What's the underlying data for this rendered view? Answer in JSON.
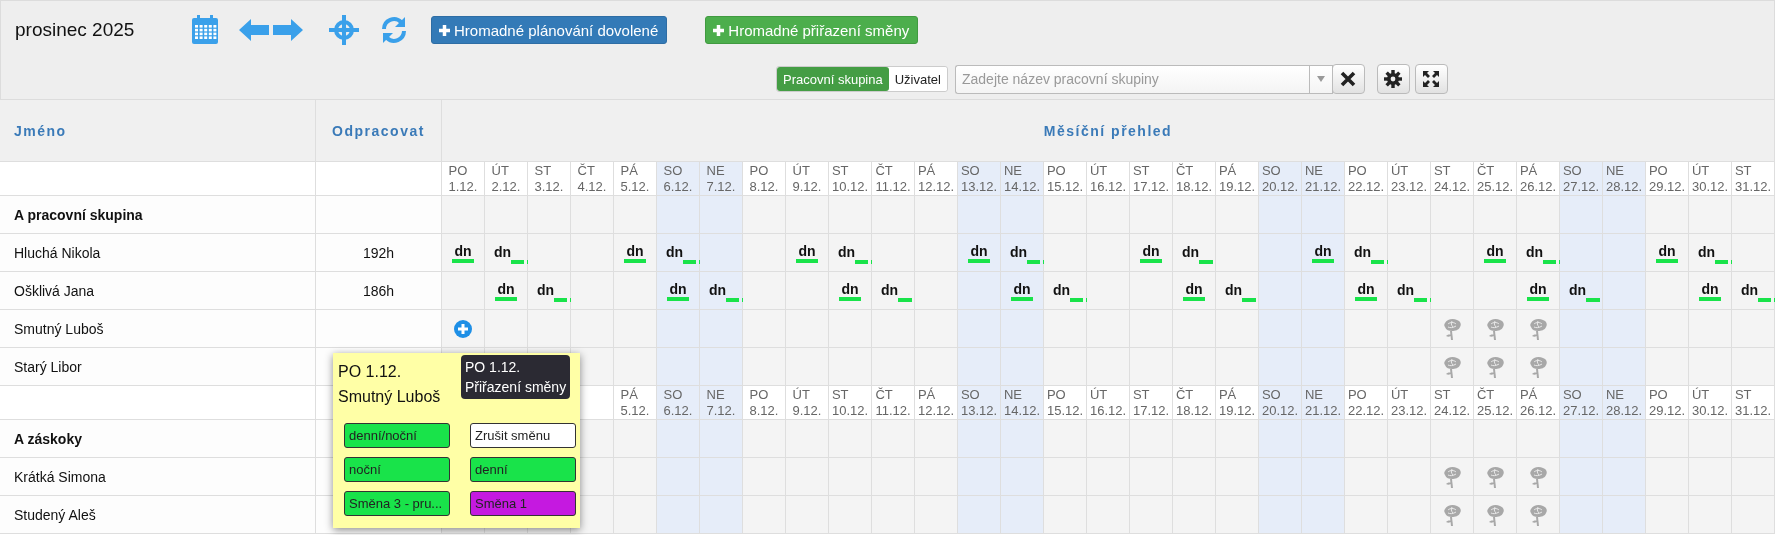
{
  "toolbar": {
    "title": "prosinec 2025",
    "buttons": [
      {
        "label": "Hromadné plánování dovolené",
        "kind": "primary"
      },
      {
        "label": "Hromadné přiřazení směny",
        "kind": "success"
      }
    ],
    "filter_toggle": [
      {
        "label": "Pracovní skupina",
        "selected": true
      },
      {
        "label": "Uživatel",
        "selected": false
      }
    ],
    "search": {
      "placeholder": "Zadejte název pracovní skupiny"
    }
  },
  "table": {
    "columns": [
      "Jméno",
      "Odpracovat",
      "Měsíční přehled"
    ],
    "days": [
      {
        "weekday": "PO",
        "date": "1.12.",
        "weekend": false
      },
      {
        "weekday": "ÚT",
        "date": "2.12.",
        "weekend": false
      },
      {
        "weekday": "ST",
        "date": "3.12.",
        "weekend": false
      },
      {
        "weekday": "ČT",
        "date": "4.12.",
        "weekend": false
      },
      {
        "weekday": "PÁ",
        "date": "5.12.",
        "weekend": false
      },
      {
        "weekday": "SO",
        "date": "6.12.",
        "weekend": true
      },
      {
        "weekday": "NE",
        "date": "7.12.",
        "weekend": true
      },
      {
        "weekday": "PO",
        "date": "8.12.",
        "weekend": false
      },
      {
        "weekday": "ÚT",
        "date": "9.12.",
        "weekend": false
      },
      {
        "weekday": "ST",
        "date": "10.12.",
        "weekend": false
      },
      {
        "weekday": "ČT",
        "date": "11.12.",
        "weekend": false
      },
      {
        "weekday": "PÁ",
        "date": "12.12.",
        "weekend": false
      },
      {
        "weekday": "SO",
        "date": "13.12.",
        "weekend": true
      },
      {
        "weekday": "NE",
        "date": "14.12.",
        "weekend": true
      },
      {
        "weekday": "PO",
        "date": "15.12.",
        "weekend": false
      },
      {
        "weekday": "ÚT",
        "date": "16.12.",
        "weekend": false
      },
      {
        "weekday": "ST",
        "date": "17.12.",
        "weekend": false
      },
      {
        "weekday": "ČT",
        "date": "18.12.",
        "weekend": false
      },
      {
        "weekday": "PÁ",
        "date": "19.12.",
        "weekend": false
      },
      {
        "weekday": "SO",
        "date": "20.12.",
        "weekend": true
      },
      {
        "weekday": "NE",
        "date": "21.12.",
        "weekend": true
      },
      {
        "weekday": "PO",
        "date": "22.12.",
        "weekend": false
      },
      {
        "weekday": "ÚT",
        "date": "23.12.",
        "weekend": false
      },
      {
        "weekday": "ST",
        "date": "24.12.",
        "weekend": false
      },
      {
        "weekday": "ČT",
        "date": "25.12.",
        "weekend": false
      },
      {
        "weekday": "PÁ",
        "date": "26.12.",
        "weekend": false
      },
      {
        "weekday": "SO",
        "date": "27.12.",
        "weekend": true
      },
      {
        "weekday": "NE",
        "date": "28.12.",
        "weekend": true
      },
      {
        "weekday": "PO",
        "date": "29.12.",
        "weekend": false
      },
      {
        "weekday": "ÚT",
        "date": "30.12.",
        "weekend": false
      },
      {
        "weekday": "ST",
        "date": "31.12.",
        "weekend": false
      }
    ],
    "rows": [
      {
        "kind": "group",
        "name": "A pracovní skupina"
      },
      {
        "kind": "person",
        "name": "Hluchá Nikola",
        "hours": "192h",
        "cells": [
          {
            "kind": "shift",
            "label": "dn"
          },
          {
            "kind": "overnight",
            "label": "dn"
          },
          {
            "kind": "empty"
          },
          {
            "kind": "empty"
          },
          {
            "kind": "shift",
            "label": "dn"
          },
          {
            "kind": "overnight",
            "label": "dn"
          },
          {
            "kind": "empty"
          },
          {
            "kind": "empty"
          },
          {
            "kind": "shift",
            "label": "dn"
          },
          {
            "kind": "overnight",
            "label": "dn"
          },
          {
            "kind": "empty"
          },
          {
            "kind": "empty"
          },
          {
            "kind": "shift",
            "label": "dn"
          },
          {
            "kind": "overnight",
            "label": "dn"
          },
          {
            "kind": "empty"
          },
          {
            "kind": "empty"
          },
          {
            "kind": "shift",
            "label": "dn"
          },
          {
            "kind": "overnight",
            "label": "dn"
          },
          {
            "kind": "empty"
          },
          {
            "kind": "empty"
          },
          {
            "kind": "shift",
            "label": "dn"
          },
          {
            "kind": "overnight",
            "label": "dn"
          },
          {
            "kind": "empty"
          },
          {
            "kind": "empty"
          },
          {
            "kind": "shift",
            "label": "dn"
          },
          {
            "kind": "overnight",
            "label": "dn"
          },
          {
            "kind": "empty"
          },
          {
            "kind": "empty"
          },
          {
            "kind": "shift",
            "label": "dn"
          },
          {
            "kind": "overnight",
            "label": "dn"
          },
          {
            "kind": "empty"
          }
        ]
      },
      {
        "kind": "person",
        "name": "Ošklivá Jana",
        "hours": "186h",
        "cells": [
          {
            "kind": "empty"
          },
          {
            "kind": "shift",
            "label": "dn"
          },
          {
            "kind": "overnight",
            "label": "dn"
          },
          {
            "kind": "empty"
          },
          {
            "kind": "empty"
          },
          {
            "kind": "shift",
            "label": "dn"
          },
          {
            "kind": "overnight",
            "label": "dn"
          },
          {
            "kind": "empty"
          },
          {
            "kind": "empty"
          },
          {
            "kind": "shift",
            "label": "dn"
          },
          {
            "kind": "overnight",
            "label": "dn"
          },
          {
            "kind": "empty"
          },
          {
            "kind": "empty"
          },
          {
            "kind": "shift",
            "label": "dn"
          },
          {
            "kind": "overnight",
            "label": "dn"
          },
          {
            "kind": "empty"
          },
          {
            "kind": "empty"
          },
          {
            "kind": "shift",
            "label": "dn"
          },
          {
            "kind": "overnight",
            "label": "dn"
          },
          {
            "kind": "empty"
          },
          {
            "kind": "empty"
          },
          {
            "kind": "shift",
            "label": "dn"
          },
          {
            "kind": "overnight",
            "label": "dn"
          },
          {
            "kind": "empty"
          },
          {
            "kind": "empty"
          },
          {
            "kind": "shift",
            "label": "dn"
          },
          {
            "kind": "overnight",
            "label": "dn"
          },
          {
            "kind": "empty"
          },
          {
            "kind": "empty"
          },
          {
            "kind": "shift",
            "label": "dn"
          },
          {
            "kind": "overnight",
            "label": "dn"
          }
        ]
      },
      {
        "kind": "person",
        "name": "Smutný Luboš",
        "cells": [
          {
            "kind": "add"
          },
          {
            "kind": "empty"
          },
          {
            "kind": "empty"
          },
          {
            "kind": "empty"
          },
          {
            "kind": "empty"
          },
          {
            "kind": "empty"
          },
          {
            "kind": "empty"
          },
          {
            "kind": "empty"
          },
          {
            "kind": "empty"
          },
          {
            "kind": "empty"
          },
          {
            "kind": "empty"
          },
          {
            "kind": "empty"
          },
          {
            "kind": "empty"
          },
          {
            "kind": "empty"
          },
          {
            "kind": "empty"
          },
          {
            "kind": "empty"
          },
          {
            "kind": "empty"
          },
          {
            "kind": "empty"
          },
          {
            "kind": "empty"
          },
          {
            "kind": "empty"
          },
          {
            "kind": "empty"
          },
          {
            "kind": "empty"
          },
          {
            "kind": "empty"
          },
          {
            "kind": "holiday"
          },
          {
            "kind": "holiday"
          },
          {
            "kind": "holiday"
          },
          {
            "kind": "empty"
          },
          {
            "kind": "empty"
          },
          {
            "kind": "empty"
          },
          {
            "kind": "empty"
          },
          {
            "kind": "empty"
          }
        ]
      },
      {
        "kind": "person",
        "name": "Starý Libor",
        "cells": [
          {
            "kind": "empty"
          },
          {
            "kind": "empty"
          },
          {
            "kind": "empty"
          },
          {
            "kind": "empty"
          },
          {
            "kind": "empty"
          },
          {
            "kind": "empty"
          },
          {
            "kind": "empty"
          },
          {
            "kind": "empty"
          },
          {
            "kind": "empty"
          },
          {
            "kind": "empty"
          },
          {
            "kind": "empty"
          },
          {
            "kind": "empty"
          },
          {
            "kind": "empty"
          },
          {
            "kind": "empty"
          },
          {
            "kind": "empty"
          },
          {
            "kind": "empty"
          },
          {
            "kind": "empty"
          },
          {
            "kind": "empty"
          },
          {
            "kind": "empty"
          },
          {
            "kind": "empty"
          },
          {
            "kind": "empty"
          },
          {
            "kind": "empty"
          },
          {
            "kind": "empty"
          },
          {
            "kind": "holiday"
          },
          {
            "kind": "holiday"
          },
          {
            "kind": "holiday"
          },
          {
            "kind": "empty"
          },
          {
            "kind": "empty"
          },
          {
            "kind": "empty"
          },
          {
            "kind": "empty"
          },
          {
            "kind": "empty"
          }
        ]
      },
      {
        "kind": "days",
        "days": [
          {
            "weekday": "PÁ",
            "date": "5.12.",
            "weekend": false
          },
          {
            "weekday": "SO",
            "date": "6.12.",
            "weekend": true
          },
          {
            "weekday": "NE",
            "date": "7.12.",
            "weekend": true
          },
          {
            "weekday": "PO",
            "date": "8.12.",
            "weekend": false
          },
          {
            "weekday": "ÚT",
            "date": "9.12.",
            "weekend": false
          },
          {
            "weekday": "ST",
            "date": "10.12.",
            "weekend": false
          },
          {
            "weekday": "ČT",
            "date": "11.12.",
            "weekend": false
          },
          {
            "weekday": "PÁ",
            "date": "12.12.",
            "weekend": false
          },
          {
            "weekday": "SO",
            "date": "13.12.",
            "weekend": true
          },
          {
            "weekday": "NE",
            "date": "14.12.",
            "weekend": true
          },
          {
            "weekday": "PO",
            "date": "15.12.",
            "weekend": false
          },
          {
            "weekday": "ÚT",
            "date": "16.12.",
            "weekend": false
          },
          {
            "weekday": "ST",
            "date": "17.12.",
            "weekend": false
          },
          {
            "weekday": "ČT",
            "date": "18.12.",
            "weekend": false
          },
          {
            "weekday": "PÁ",
            "date": "19.12.",
            "weekend": false
          },
          {
            "weekday": "SO",
            "date": "20.12.",
            "weekend": true
          },
          {
            "weekday": "NE",
            "date": "21.12.",
            "weekend": true
          },
          {
            "weekday": "PO",
            "date": "22.12.",
            "weekend": false
          },
          {
            "weekday": "ÚT",
            "date": "23.12.",
            "weekend": false
          },
          {
            "weekday": "ST",
            "date": "24.12.",
            "weekend": false
          },
          {
            "weekday": "ČT",
            "date": "25.12.",
            "weekend": false
          },
          {
            "weekday": "PÁ",
            "date": "26.12.",
            "weekend": false
          },
          {
            "weekday": "SO",
            "date": "27.12.",
            "weekend": true
          },
          {
            "weekday": "NE",
            "date": "28.12.",
            "weekend": true
          },
          {
            "weekday": "PO",
            "date": "29.12.",
            "weekend": false
          },
          {
            "weekday": "ÚT",
            "date": "30.12.",
            "weekend": false
          },
          {
            "weekday": "ST",
            "date": "31.12.",
            "weekend": false
          }
        ]
      },
      {
        "kind": "group",
        "name": "A záskoky"
      },
      {
        "kind": "person",
        "name": "Krátká Simona",
        "cells": [
          {
            "kind": "empty"
          },
          {
            "kind": "empty"
          },
          {
            "kind": "empty"
          },
          {
            "kind": "empty"
          },
          {
            "kind": "empty"
          },
          {
            "kind": "empty"
          },
          {
            "kind": "empty"
          },
          {
            "kind": "empty"
          },
          {
            "kind": "empty"
          },
          {
            "kind": "empty"
          },
          {
            "kind": "empty"
          },
          {
            "kind": "empty"
          },
          {
            "kind": "empty"
          },
          {
            "kind": "empty"
          },
          {
            "kind": "empty"
          },
          {
            "kind": "empty"
          },
          {
            "kind": "empty"
          },
          {
            "kind": "empty"
          },
          {
            "kind": "empty"
          },
          {
            "kind": "empty"
          },
          {
            "kind": "empty"
          },
          {
            "kind": "empty"
          },
          {
            "kind": "empty"
          },
          {
            "kind": "holiday"
          },
          {
            "kind": "holiday"
          },
          {
            "kind": "holiday"
          },
          {
            "kind": "empty"
          },
          {
            "kind": "empty"
          },
          {
            "kind": "empty"
          },
          {
            "kind": "empty"
          },
          {
            "kind": "empty"
          }
        ]
      },
      {
        "kind": "person",
        "name": "Studený Aleš",
        "cells": [
          {
            "kind": "empty"
          },
          {
            "kind": "empty"
          },
          {
            "kind": "empty"
          },
          {
            "kind": "empty"
          },
          {
            "kind": "empty"
          },
          {
            "kind": "empty"
          },
          {
            "kind": "empty"
          },
          {
            "kind": "empty"
          },
          {
            "kind": "empty"
          },
          {
            "kind": "empty"
          },
          {
            "kind": "empty"
          },
          {
            "kind": "empty"
          },
          {
            "kind": "empty"
          },
          {
            "kind": "empty"
          },
          {
            "kind": "empty"
          },
          {
            "kind": "empty"
          },
          {
            "kind": "empty"
          },
          {
            "kind": "empty"
          },
          {
            "kind": "empty"
          },
          {
            "kind": "empty"
          },
          {
            "kind": "empty"
          },
          {
            "kind": "empty"
          },
          {
            "kind": "empty"
          },
          {
            "kind": "holiday"
          },
          {
            "kind": "holiday"
          },
          {
            "kind": "holiday"
          },
          {
            "kind": "empty"
          },
          {
            "kind": "empty"
          },
          {
            "kind": "empty"
          },
          {
            "kind": "empty"
          },
          {
            "kind": "empty"
          }
        ]
      }
    ]
  },
  "popup": {
    "date": "PO 1.12.",
    "person": "Smutný Luboš",
    "tooltip": {
      "date": "PO 1.12.",
      "title": "Přiřazení směny"
    },
    "options": [
      {
        "label": "denní/noční",
        "color": "#19e34a"
      },
      {
        "label": "Zrušit směnu",
        "color": "#ffffff"
      },
      {
        "label": "noční",
        "color": "#19e34a"
      },
      {
        "label": "denní",
        "color": "#19e34a"
      },
      {
        "label": "Směna 3 - pru...",
        "color": "#19e34a"
      },
      {
        "label": "Směna 1",
        "color": "#c519e0"
      }
    ]
  }
}
